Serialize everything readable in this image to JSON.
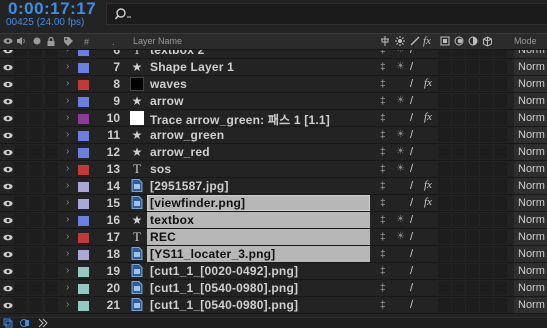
{
  "timecode": "0:00:17:17",
  "frame_info": "00425 (24.00 fps)",
  "search": {
    "placeholder": ""
  },
  "header": {
    "layer_name": "Layer Name",
    "mode": "Mode"
  },
  "colors": {
    "accent": "#3d8ee6",
    "label_blue": "#6a7fe0",
    "label_red": "#c0393b",
    "label_purple": "#8e3a9a",
    "label_lavender": "#a9a6d8",
    "label_aqua": "#96c8c2"
  },
  "layers": [
    {
      "num": "6",
      "type": "text",
      "name": "textbox 2",
      "label": "#6a7fe0",
      "fx": false,
      "selected": false,
      "mode": "Norm"
    },
    {
      "num": "7",
      "type": "shape",
      "name": "Shape Layer 1",
      "label": "#6a7fe0",
      "fx": false,
      "selected": false,
      "mode": "Norm"
    },
    {
      "num": "8",
      "type": "solid",
      "name": "waves",
      "label": "#c0393b",
      "fx": true,
      "selected": false,
      "mode": "Norm"
    },
    {
      "num": "9",
      "type": "shape",
      "name": "arrow",
      "label": "#6a7fe0",
      "fx": false,
      "selected": false,
      "mode": "Norm"
    },
    {
      "num": "10",
      "type": "white",
      "name": "Trace arrow_green: 패스 1 [1.1]",
      "label": "#8e3a9a",
      "fx": true,
      "selected": false,
      "mode": "Norm"
    },
    {
      "num": "11",
      "type": "shape",
      "name": "arrow_green",
      "label": "#6a7fe0",
      "fx": false,
      "selected": false,
      "mode": "Norm"
    },
    {
      "num": "12",
      "type": "shape",
      "name": "arrow_red",
      "label": "#6a7fe0",
      "fx": false,
      "selected": false,
      "mode": "Norm"
    },
    {
      "num": "13",
      "type": "text",
      "name": "sos",
      "label": "#c0393b",
      "fx": false,
      "selected": false,
      "mode": "Norm"
    },
    {
      "num": "14",
      "type": "image",
      "name": "[2951587.jpg]",
      "label": "#a9a6d8",
      "fx": true,
      "selected": false,
      "mode": "Norm"
    },
    {
      "num": "15",
      "type": "image",
      "name": "[viewfinder.png]",
      "label": "#a9a6d8",
      "fx": true,
      "selected": true,
      "mode": "Norm"
    },
    {
      "num": "16",
      "type": "shape",
      "name": "textbox",
      "label": "#6a7fe0",
      "fx": false,
      "selected": true,
      "mode": "Norm"
    },
    {
      "num": "17",
      "type": "text",
      "name": "REC",
      "label": "#c0393b",
      "fx": false,
      "selected": true,
      "mode": "Norm"
    },
    {
      "num": "18",
      "type": "image",
      "name": "[YS11_locater_3.png]",
      "label": "#a9a6d8",
      "fx": false,
      "selected": true,
      "mode": "Norm"
    },
    {
      "num": "19",
      "type": "image",
      "name": "[cut1_1_[0020-0492].png]",
      "label": "#96c8c2",
      "fx": false,
      "selected": false,
      "mode": "Norm"
    },
    {
      "num": "20",
      "type": "image",
      "name": "[cut1_1_[0540-0980].png]",
      "label": "#96c8c2",
      "fx": false,
      "selected": false,
      "mode": "Norm"
    },
    {
      "num": "21",
      "type": "image",
      "name": "[cut1_1_[0540-0980].png]",
      "label": "#96c8c2",
      "fx": false,
      "selected": false,
      "mode": "Norm"
    }
  ]
}
